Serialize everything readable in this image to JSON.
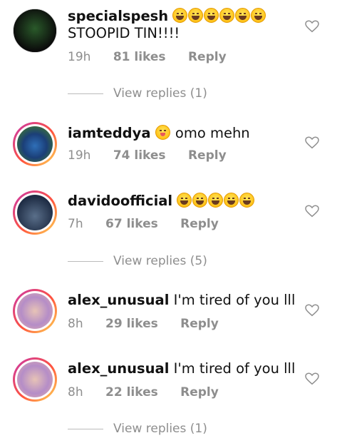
{
  "comments": [
    {
      "username": "specialspesh",
      "text": "",
      "second_line": "STOOPID TIN!!!!",
      "time": "19h",
      "likes": "81 likes",
      "reply": "Reply",
      "emoji": [
        "rolling-on-floor-laughing",
        "rolling-on-floor-laughing",
        "rolling-on-floor-laughing",
        "rolling-on-floor-laughing",
        "rolling-on-floor-laughing",
        "rolling-on-floor-laughing"
      ],
      "view_replies": "View replies (1)",
      "avatar_ring": false
    },
    {
      "username": "iamteddya",
      "text": "omo mehn",
      "time": "19h",
      "likes": "74 likes",
      "reply": "Reply",
      "emoji": [
        "face-savoring-food"
      ],
      "avatar_ring": true
    },
    {
      "username": "davidoofficial",
      "text": "",
      "time": "7h",
      "likes": "67 likes",
      "reply": "Reply",
      "emoji": [
        "rolling-on-floor-laughing",
        "rolling-on-floor-laughing",
        "rolling-on-floor-laughing",
        "rolling-on-floor-laughing",
        "rolling-on-floor-laughing"
      ],
      "view_replies": "View replies (5)",
      "avatar_ring": true
    },
    {
      "username": "alex_unusual",
      "text": "I'm tired of you lll",
      "time": "8h",
      "likes": "29 likes",
      "reply": "Reply",
      "avatar_ring": true
    },
    {
      "username": "alex_unusual",
      "text": "I'm tired of you lll",
      "time": "8h",
      "likes": "22 likes",
      "reply": "Reply",
      "view_replies": "View replies (1)",
      "avatar_ring": true
    }
  ],
  "icons": {
    "like": "heart-outline-icon"
  },
  "colors": {
    "meta_text": "#8e8e8e",
    "ring_start": "#c837ab",
    "ring_end": "#ffdd55"
  }
}
